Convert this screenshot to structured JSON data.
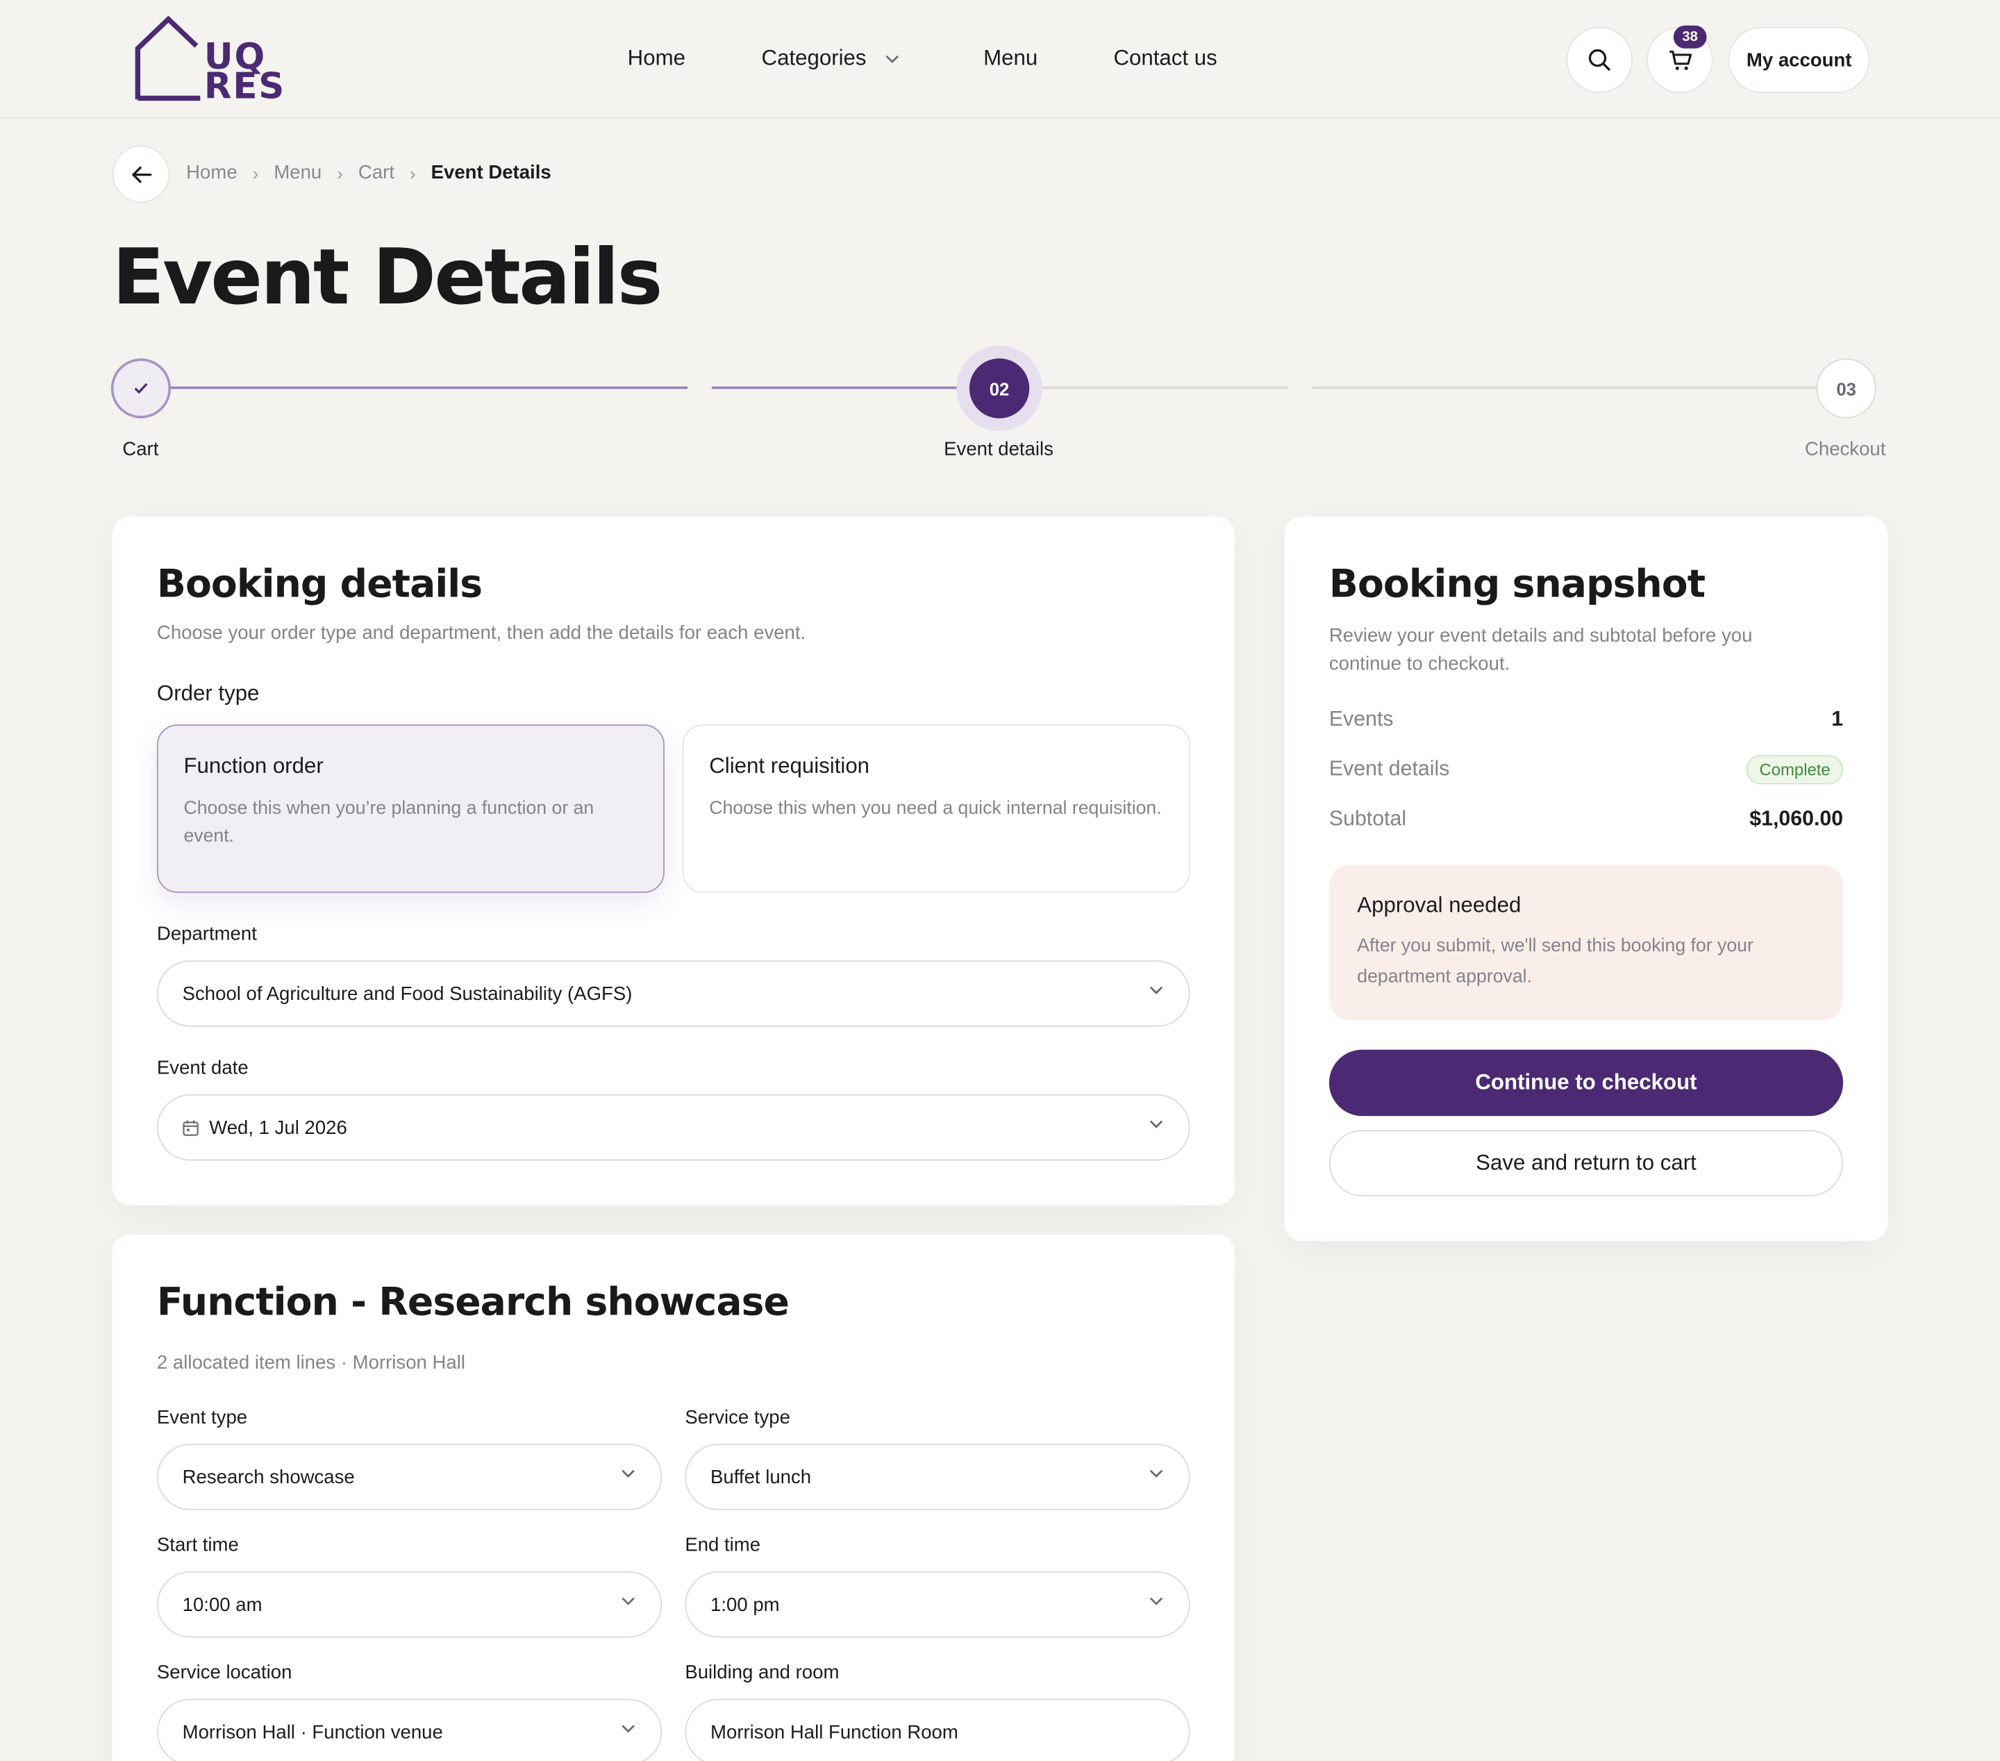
{
  "brand": {
    "logo_line1": "UQ",
    "logo_line2": "RES",
    "accent": "#4b2a73"
  },
  "nav": {
    "home": "Home",
    "categories": "Categories",
    "menu": "Menu",
    "contact": "Contact us"
  },
  "header": {
    "cart_count": "38",
    "account_label": "My account"
  },
  "breadcrumb": {
    "items": [
      "Home",
      "Menu",
      "Cart"
    ],
    "current": "Event Details"
  },
  "page": {
    "title": "Event Details"
  },
  "stepper": {
    "steps": [
      {
        "number": "",
        "label": "Cart",
        "state": "done"
      },
      {
        "number": "02",
        "label": "Event details",
        "state": "active"
      },
      {
        "number": "03",
        "label": "Checkout",
        "state": "upcoming"
      }
    ]
  },
  "booking": {
    "title": "Booking details",
    "subtitle": "Choose your order type and department, then add the details for each event.",
    "order_type_label": "Order type",
    "options": [
      {
        "title": "Function order",
        "desc": "Choose this when you’re planning a function or an event.",
        "selected": true
      },
      {
        "title": "Client requisition",
        "desc": "Choose this when you need a quick internal requisition.",
        "selected": false
      }
    ],
    "department_label": "Department",
    "department_value": "School of Agriculture and Food Sustainability (AGFS)",
    "event_date_label": "Event date",
    "event_date_value": "Wed, 1 Jul 2026"
  },
  "function": {
    "title": "Function - Research showcase",
    "meta": "2 allocated item lines · Morrison Hall",
    "event_type_label": "Event type",
    "event_type_value": "Research showcase",
    "service_type_label": "Service type",
    "service_type_value": "Buffet lunch",
    "start_time_label": "Start time",
    "start_time_value": "10:00 am",
    "end_time_label": "End time",
    "end_time_value": "1:00 pm",
    "service_location_label": "Service location",
    "service_location_value": "Morrison Hall · Function venue",
    "building_room_label": "Building and room",
    "building_room_value": "Morrison Hall Function Room"
  },
  "snapshot": {
    "title": "Booking snapshot",
    "subtitle": "Review your event details and subtotal before you continue to checkout.",
    "events_label": "Events",
    "events_value": "1",
    "details_label": "Event details",
    "details_value": "Complete",
    "subtotal_label": "Subtotal",
    "subtotal_value": "$1,060.00",
    "approval_title": "Approval needed",
    "approval_desc": "After you submit, we'll send this booking for your department approval.",
    "checkout_label": "Continue to checkout",
    "save_label": "Save and return to cart"
  }
}
